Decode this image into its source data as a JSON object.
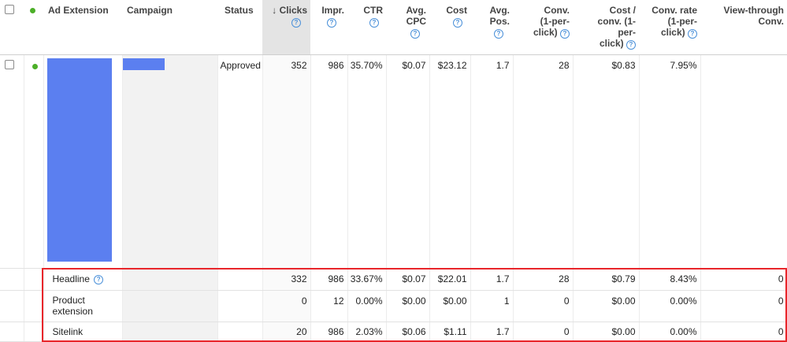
{
  "columns": {
    "ad_extension": "Ad Extension",
    "campaign": "Campaign",
    "status": "Status",
    "clicks": "Clicks",
    "impr": "Impr.",
    "ctr": "CTR",
    "avg_cpc": "Avg. CPC",
    "cost": "Cost",
    "avg_pos": "Avg. Pos.",
    "conv": "Conv. (1-per-click)",
    "cost_conv": "Cost / conv. (1-per-click)",
    "conv_rate": "Conv. rate (1-per-click)",
    "view_through": "View-through Conv."
  },
  "sort": {
    "arrow": "↓"
  },
  "help_glyph": "?",
  "main_row": {
    "status": "Approved",
    "clicks": "352",
    "impr": "986",
    "ctr": "35.70%",
    "avg_cpc": "$0.07",
    "cost": "$23.12",
    "avg_pos": "1.7",
    "conv": "28",
    "cost_conv": "$0.83",
    "conv_rate": "7.95%",
    "view_through": ""
  },
  "sub_rows": [
    {
      "label": "Headline",
      "clicks": "332",
      "impr": "986",
      "ctr": "33.67%",
      "avg_cpc": "$0.07",
      "cost": "$22.01",
      "avg_pos": "1.7",
      "conv": "28",
      "cost_conv": "$0.79",
      "conv_rate": "8.43%",
      "view_through": "0"
    },
    {
      "label": "Product extension",
      "clicks": "0",
      "impr": "12",
      "ctr": "0.00%",
      "avg_cpc": "$0.00",
      "cost": "$0.00",
      "avg_pos": "1",
      "conv": "0",
      "cost_conv": "$0.00",
      "conv_rate": "0.00%",
      "view_through": "0"
    },
    {
      "label": "Sitelink",
      "clicks": "20",
      "impr": "986",
      "ctr": "2.03%",
      "avg_cpc": "$0.06",
      "cost": "$1.11",
      "avg_pos": "1.7",
      "conv": "0",
      "cost_conv": "$0.00",
      "conv_rate": "0.00%",
      "view_through": "0"
    }
  ],
  "colors": {
    "accent": "#5b7ff0",
    "status_dot": "#4caf28",
    "highlight": "#e8262b",
    "help": "#4a90d9"
  }
}
